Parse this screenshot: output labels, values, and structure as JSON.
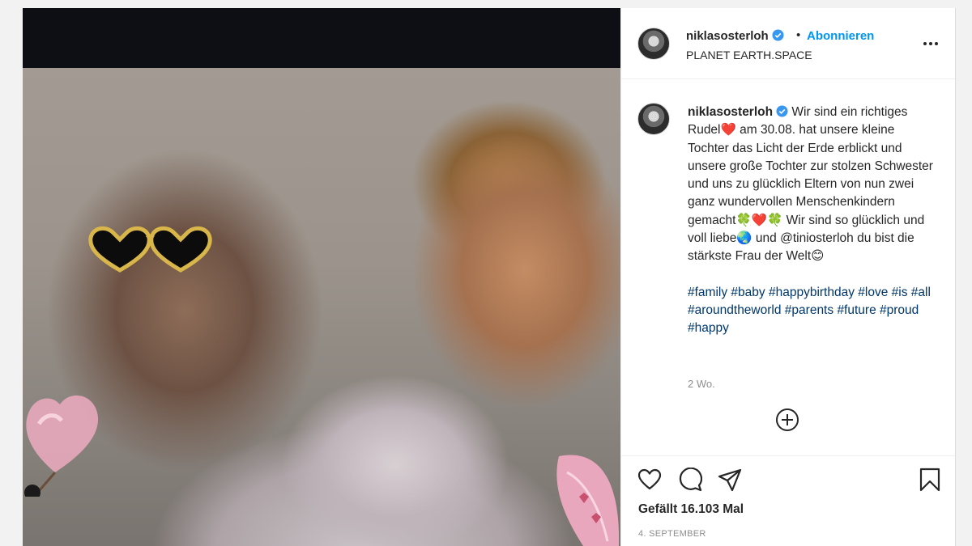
{
  "post": {
    "username": "niklasosterloh",
    "location": "PLANET EARTH.SPACE",
    "follow_label": "Abonnieren",
    "separator": "•",
    "caption_user": "niklasosterloh",
    "caption_text": "Wir sind ein richtiges Rudel❤️ am 30.08. hat unsere kleine Tochter das Licht der Erde erblickt und unsere große Tochter zur stolzen Schwester und uns zu glücklich Eltern von nun zwei ganz wundervollen Menschenkindern gemacht🍀❤️🍀 Wir sind so glücklich und voll liebe🌏 und @tiniosterloh du bist die stärkste Frau der Welt😊",
    "hashtags": [
      "#family",
      "#baby",
      "#happybirthday",
      "#love",
      "#is",
      "#all",
      "#aroundtheworld",
      "#parents",
      "#future",
      "#proud",
      "#happy"
    ],
    "time_ago": "2 Wo.",
    "likes": "Gefällt 16.103 Mal",
    "date": "4. SEPTEMBER"
  },
  "icons": {
    "verified": "verified-badge-icon",
    "more": "more-options-icon",
    "add_comment": "plus-circle-icon",
    "like": "heart-icon",
    "comment": "comment-icon",
    "share": "share-icon",
    "save": "bookmark-icon"
  },
  "colors": {
    "link": "#0095f6",
    "hashtag": "#00376b",
    "muted": "#8e8e8e"
  }
}
